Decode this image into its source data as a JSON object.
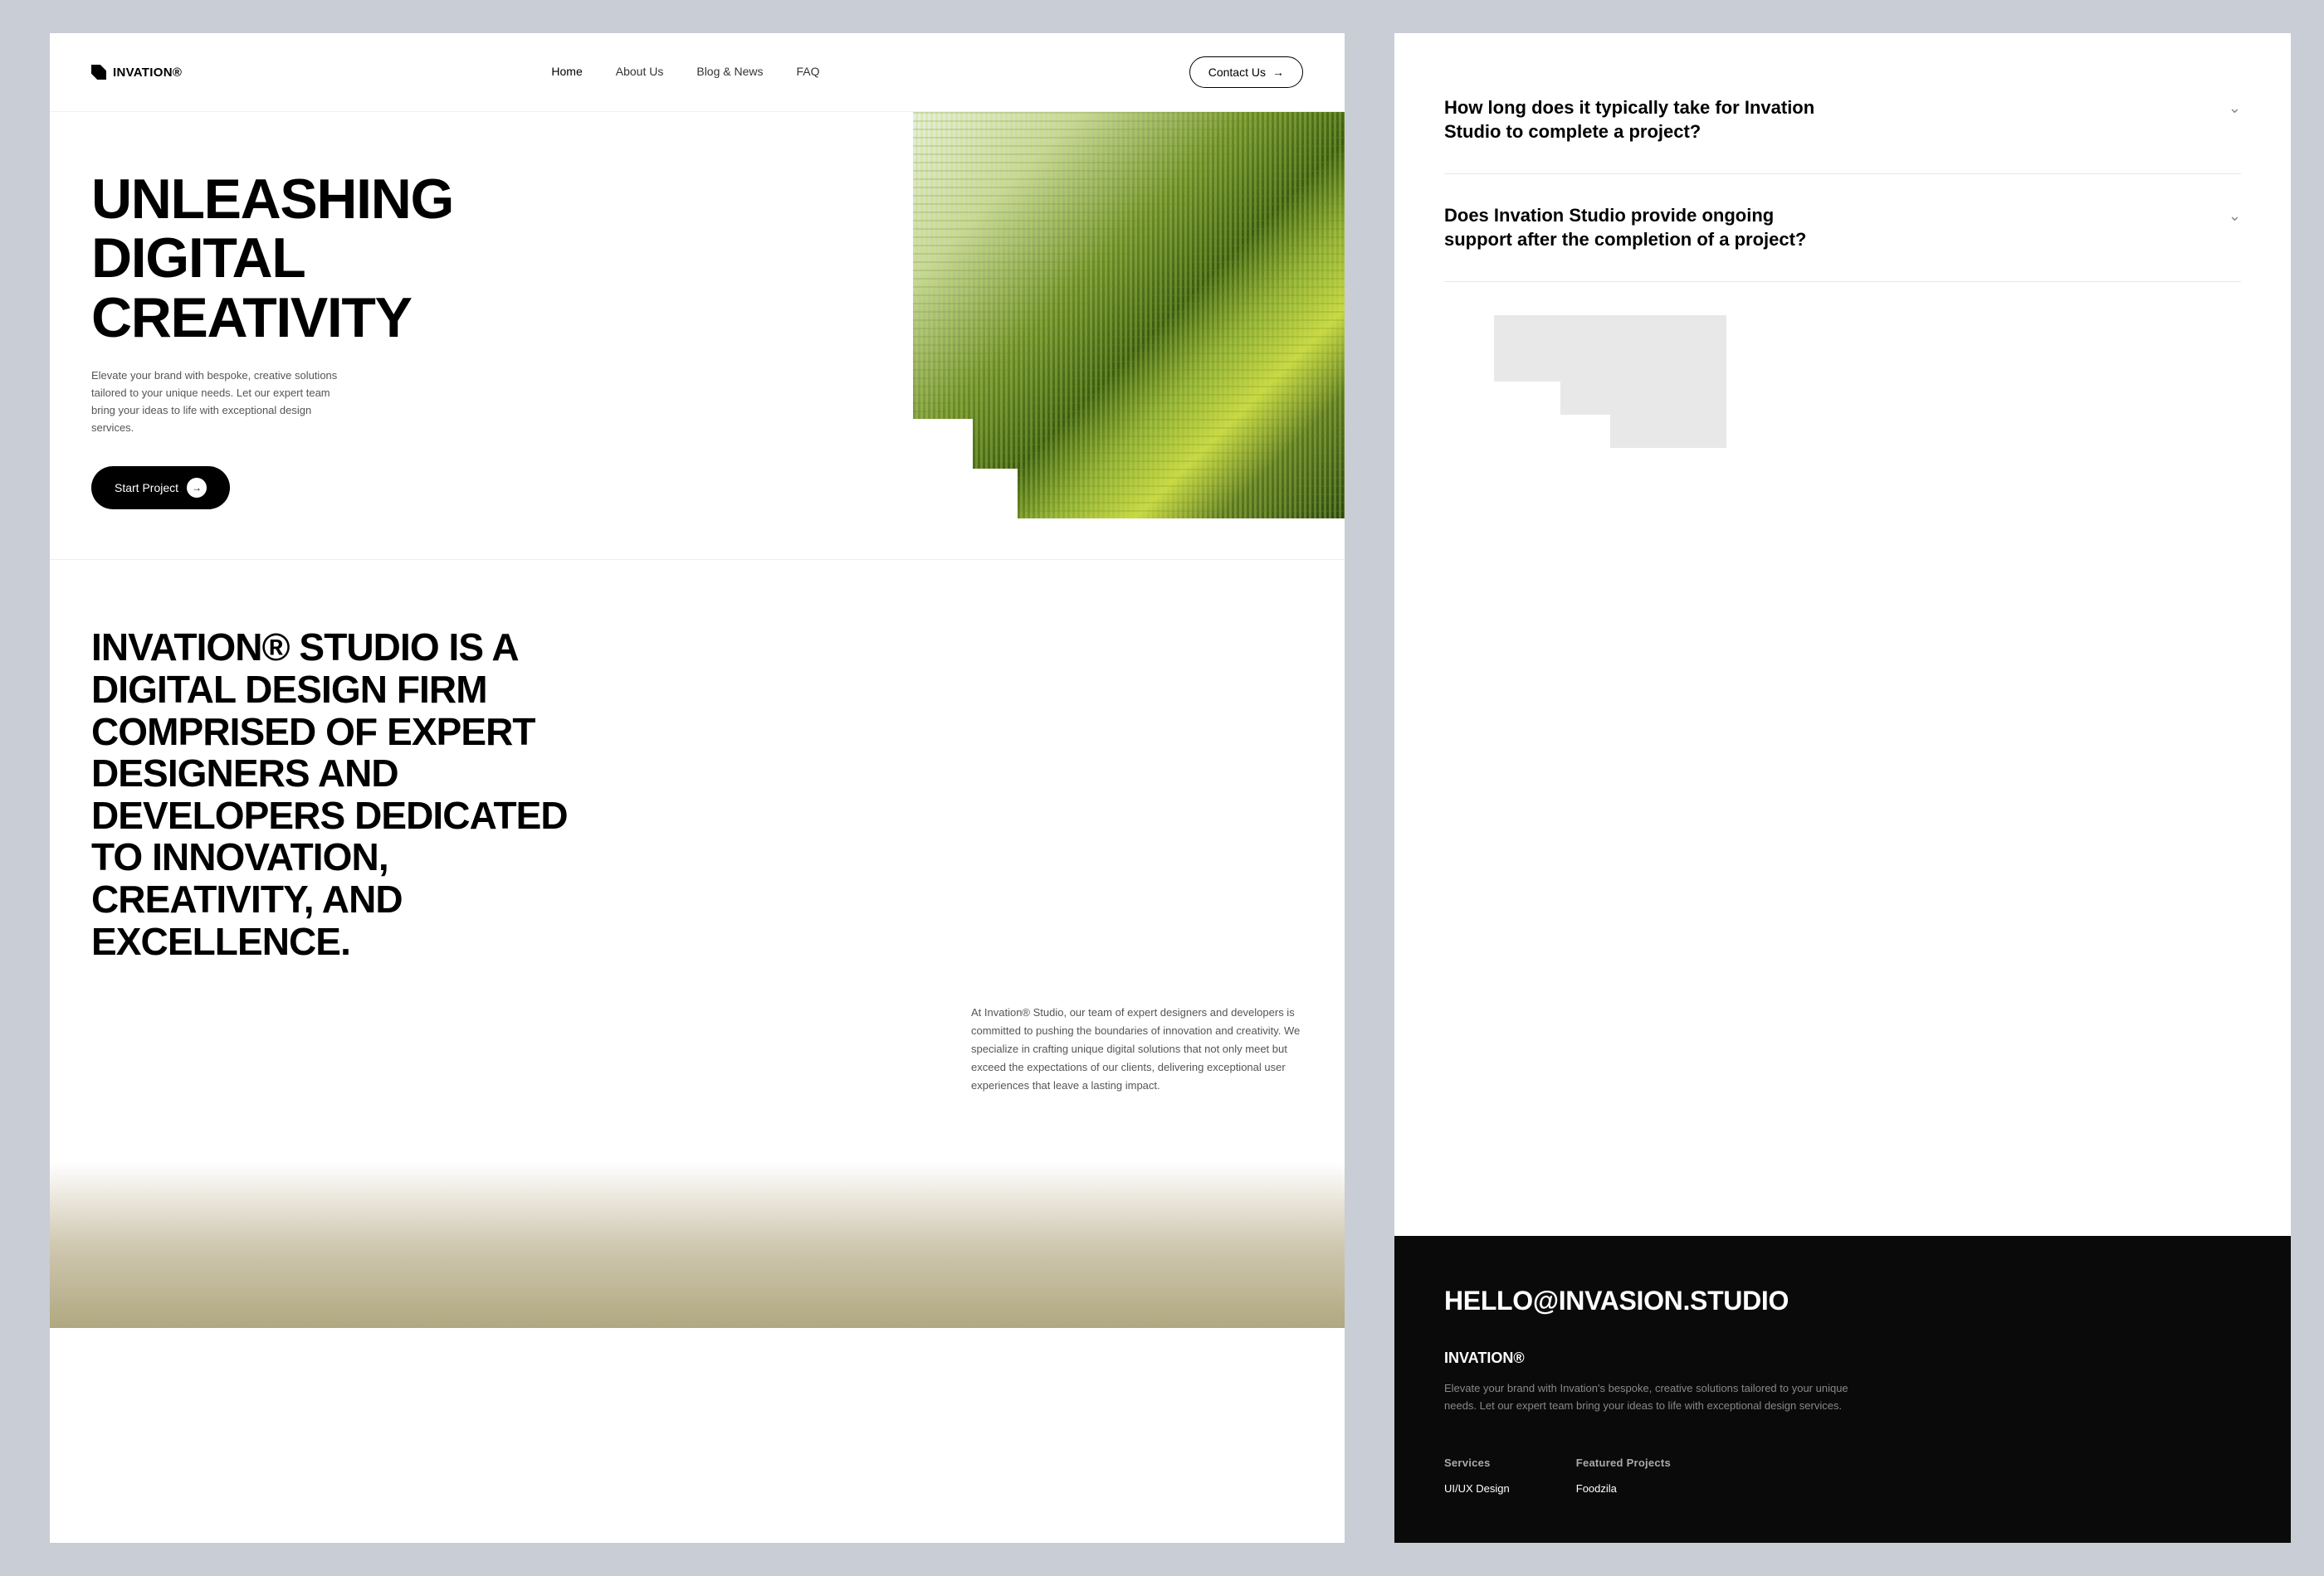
{
  "brand": {
    "name": "INVATION®",
    "email": "HELLO@INVASION.STUDIO"
  },
  "nav": {
    "home": "Home",
    "about": "About Us",
    "blog": "Blog & News",
    "faq": "FAQ",
    "contact": "Contact Us"
  },
  "hero": {
    "heading_line1": "UNLEASHING",
    "heading_line2": "DIGITAL CREATIVITY",
    "subtitle": "Elevate your brand with bespoke, creative solutions tailored to your unique needs. Let our expert team bring your ideas to life with exceptional design services.",
    "cta": "Start Project"
  },
  "about": {
    "heading": "INVATION® STUDIO IS A DIGITAL DESIGN FIRM COMPRISED OF EXPERT DESIGNERS AND DEVELOPERS DEDICATED TO INNOVATION, CREATIVITY, AND EXCELLENCE.",
    "body": "At Invation® Studio, our team of expert designers and developers is committed to pushing the boundaries of innovation and creativity. We specialize in crafting unique digital solutions that not only meet but exceed the expectations of our clients, delivering exceptional user experiences that leave a lasting impact."
  },
  "faq": {
    "questions": [
      {
        "q": "How long does it typically take for Invation Studio to complete a project?",
        "open": false
      },
      {
        "q": "Does Invation Studio provide ongoing support after the completion of a project?",
        "open": false
      }
    ]
  },
  "footer": {
    "brand": "INVATION®",
    "desc": "Elevate your brand with Invation's bespoke, creative solutions tailored to your unique needs. Let our expert team bring your ideas to life with exceptional design services.",
    "services_label": "Services",
    "projects_label": "Featured Projects",
    "services": [
      "UI/UX Design"
    ],
    "projects": [
      "Foodzila"
    ]
  }
}
